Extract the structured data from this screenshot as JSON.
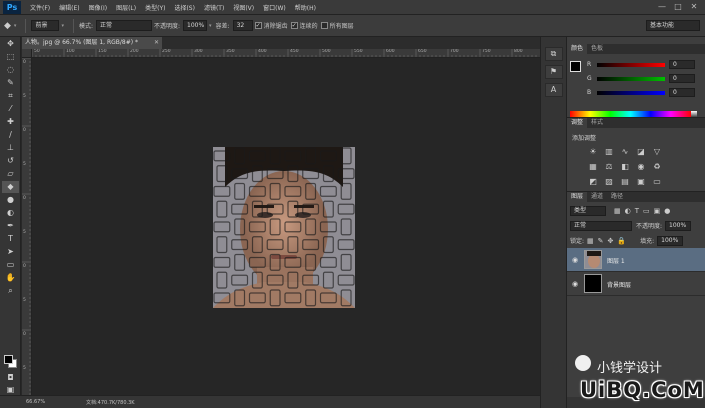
{
  "app": {
    "logo": "Ps",
    "menus": [
      "文件(F)",
      "编辑(E)",
      "图像(I)",
      "图层(L)",
      "类型(Y)",
      "选择(S)",
      "滤镜(T)",
      "视图(V)",
      "窗口(W)",
      "帮助(H)"
    ],
    "window_controls": [
      "—",
      "□",
      "✕"
    ]
  },
  "options_bar": {
    "tool_icon": "paint-bucket-icon",
    "fill_source": "前景",
    "mode_label": "模式:",
    "mode_value": "正常",
    "opacity_label": "不透明度:",
    "opacity_value": "100%",
    "tolerance_label": "容差:",
    "tolerance_value": "32",
    "antialias_label": "消除锯齿",
    "antialias_checked": true,
    "contiguous_label": "连续的",
    "contiguous_checked": true,
    "all_layers_label": "所有图层",
    "all_layers_checked": false,
    "workspace": "基本功能"
  },
  "document": {
    "tab_title": "人物。jpg @ 66.7% (图层 1, RGB/8#) *",
    "zoom": "66.67%",
    "doc_size": "文档:470.7K/780.3K"
  },
  "rulers": {
    "h_labels": [
      "50",
      "100",
      "150",
      "200",
      "250",
      "300",
      "350",
      "400",
      "450",
      "500",
      "550",
      "600",
      "650",
      "700",
      "750",
      "800"
    ],
    "v_labels": [
      "0",
      "5",
      "0",
      "5",
      "0",
      "5",
      "0",
      "5",
      "0",
      "5"
    ]
  },
  "color_panel": {
    "tabs": [
      "颜色",
      "色板"
    ],
    "r_label": "R",
    "r_value": "0",
    "g_label": "G",
    "g_value": "0",
    "b_label": "B",
    "b_value": "0"
  },
  "adjustments_panel": {
    "tabs": [
      "调整",
      "样式"
    ],
    "title": "添加调整"
  },
  "layers_panel": {
    "tabs": [
      "图层",
      "通道",
      "路径"
    ],
    "filter_type": "类型",
    "blend_mode": "正常",
    "opacity_label": "不透明度:",
    "opacity_value": "100%",
    "lock_label": "锁定:",
    "fill_label": "填充:",
    "fill_value": "100%",
    "layers": [
      {
        "name": "图层 1",
        "selected": true
      },
      {
        "name": "背景图层",
        "selected": false
      }
    ]
  },
  "watermark": {
    "name": "小钱学设计",
    "domain": "UiBQ.CoM"
  }
}
